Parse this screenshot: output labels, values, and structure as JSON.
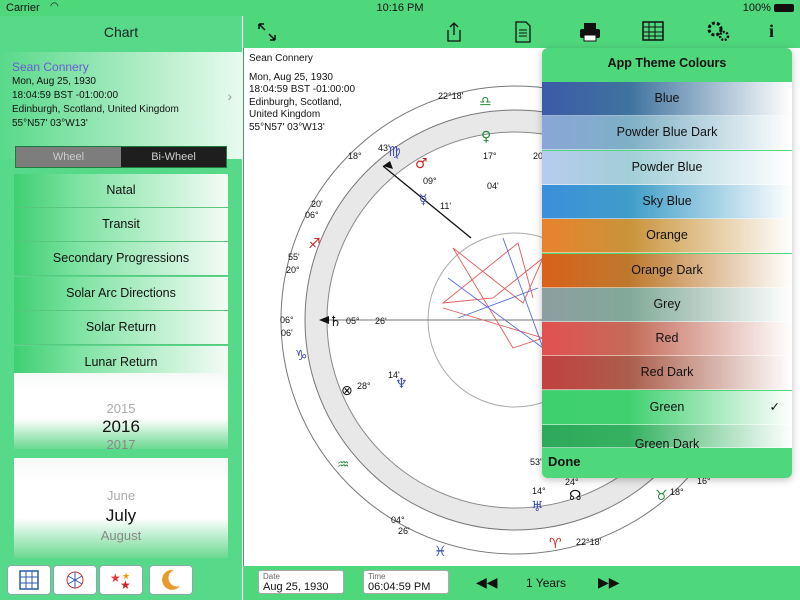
{
  "status": {
    "carrier": "Carrier",
    "time": "10:16 PM",
    "battery": "100%"
  },
  "sidebar": {
    "title": "Chart",
    "profile": {
      "name": "Sean Connery",
      "date": "Mon, Aug 25, 1930",
      "time": "18:04:59 BST -01:00:00",
      "place": "Edinburgh, Scotland, United Kingdom",
      "coords": "55°N57' 03°W13'"
    },
    "segment": {
      "wheel": "Wheel",
      "biwheel": "Bi-Wheel"
    },
    "menu": [
      "Natal",
      "Transit",
      "Secondary Progressions",
      "Solar Arc Directions",
      "Solar Return",
      "Lunar Return"
    ],
    "year_picker": [
      "2015",
      "2016",
      "2017"
    ],
    "month_picker": [
      "June",
      "July",
      "August"
    ]
  },
  "chart_header": {
    "name": "Sean Connery",
    "date": "Mon, Aug 25, 1930",
    "time": "18:04:59 BST -01:00:00",
    "place1": "Edinburgh, Scotland,",
    "place2": "United Kingdom",
    "coords": "55°N57' 03°W13'"
  },
  "wheel_labels": {
    "l1": "22°18'",
    "l2": "18°",
    "l3": "43'",
    "l4": "09°",
    "l5": "11'",
    "l6": "17°",
    "l7": "04'",
    "l8": "20'",
    "l9": "06°",
    "l10": "55'",
    "l11": "20°",
    "l12": "06°",
    "l13": "06'",
    "l14": "05°",
    "l15": "26'",
    "l16": "14'",
    "l17": "28°",
    "l18": "53'",
    "l19": "14°",
    "l20": "24°",
    "l21": "04°",
    "l22": "26'",
    "l23": "22°18'",
    "l24": "16°",
    "l25": "18°",
    "l26": "20"
  },
  "bottom": {
    "date_label": "Date",
    "date_value": "Aug 25, 1930",
    "time_label": "Time",
    "time_value": "06:04:59 PM",
    "step": "1 Years"
  },
  "theme_popup": {
    "title": "App Theme Colours",
    "options": [
      {
        "label": "Blue",
        "color": "#3c5aa8"
      },
      {
        "label": "Powder Blue Dark",
        "color": "#8aa6d8"
      },
      {
        "label": "Powder Blue",
        "color": "#b7ccef"
      },
      {
        "label": "Sky Blue",
        "color": "#3b8fdc"
      },
      {
        "label": "Orange",
        "color": "#e8822a"
      },
      {
        "label": "Orange Dark",
        "color": "#d9611a"
      },
      {
        "label": "Grey",
        "color": "#8e9ea0"
      },
      {
        "label": "Red",
        "color": "#e25050"
      },
      {
        "label": "Red Dark",
        "color": "#c24040"
      },
      {
        "label": "Green",
        "color": "#3ecf6e"
      },
      {
        "label": "Green Dark",
        "color": "#2ea85a"
      }
    ],
    "selected": "Green",
    "check": "✓",
    "done": "Done"
  }
}
